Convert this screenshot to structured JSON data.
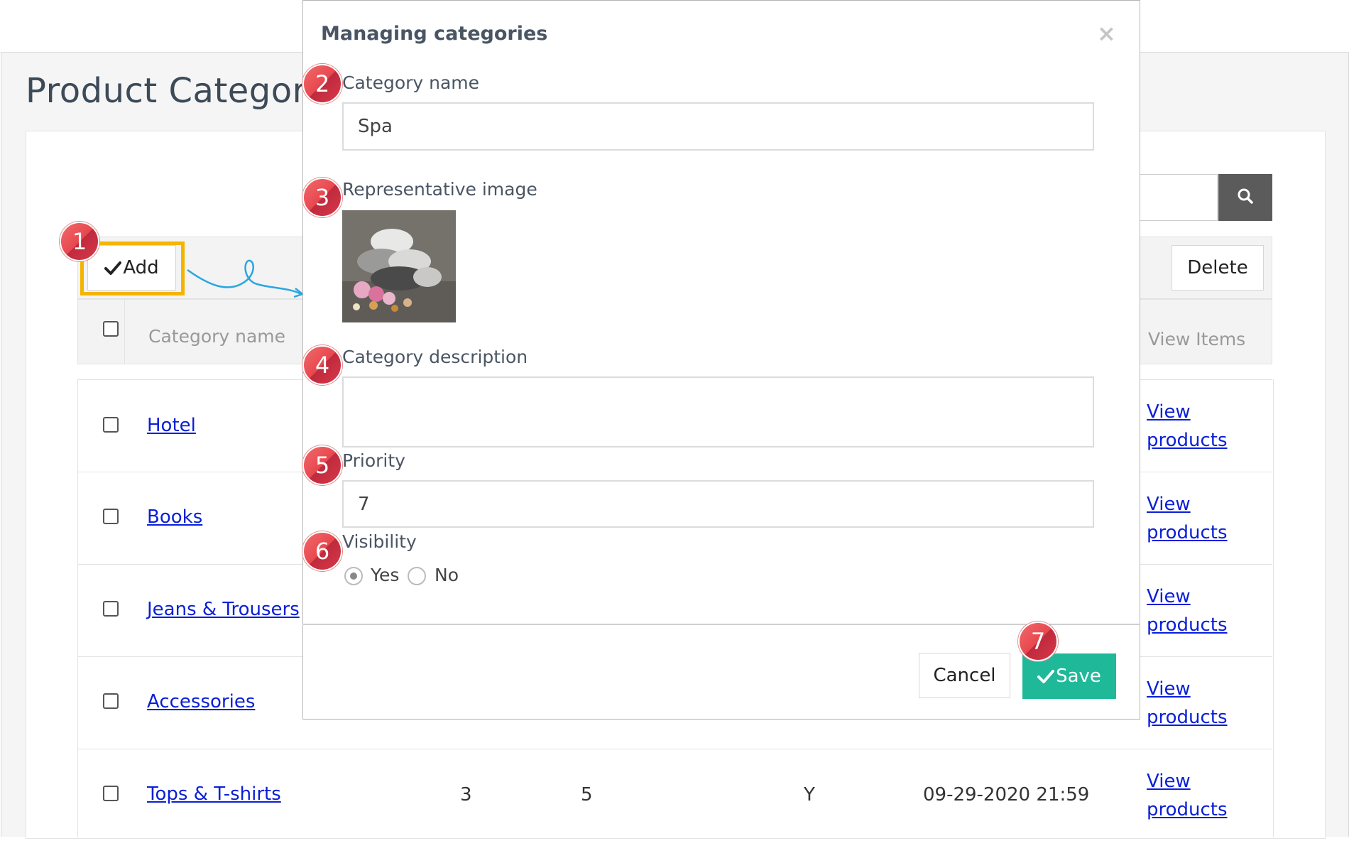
{
  "page": {
    "title": "Product Category",
    "toolbar": {
      "add_label": "Add",
      "delete_label": "Delete"
    },
    "table": {
      "headers": {
        "category_name": "Category name",
        "view_items": "View Items"
      },
      "rows": [
        {
          "name": "Hotel",
          "link": "View products"
        },
        {
          "name": "Books",
          "link": "View products"
        },
        {
          "name": "Jeans & Trousers",
          "link": "View products"
        },
        {
          "name": "Accessories",
          "link": "View products"
        },
        {
          "name": "Tops & T-shirts",
          "col2": "3",
          "col3": "5",
          "col4": "Y",
          "date": "09-29-2020 21:59",
          "link": "View products"
        }
      ]
    }
  },
  "modal": {
    "title": "Managing categories",
    "close_glyph": "×",
    "labels": {
      "category_name": "Category name",
      "image": "Representative image",
      "description": "Category description",
      "priority": "Priority",
      "visibility": "Visibility"
    },
    "values": {
      "category_name": "Spa",
      "description": "",
      "priority": "7"
    },
    "visibility_options": {
      "yes": "Yes",
      "no": "No",
      "selected": "Yes"
    },
    "buttons": {
      "cancel": "Cancel",
      "save": "Save"
    }
  },
  "badges": [
    "1",
    "2",
    "3",
    "4",
    "5",
    "6",
    "7"
  ],
  "colors": {
    "highlight": "#f5b400",
    "save": "#1fb99a",
    "link": "#0a1fd6",
    "badge": "#e8474f"
  },
  "icons": {
    "search": "search-icon",
    "check": "check-icon",
    "close": "close-icon"
  }
}
